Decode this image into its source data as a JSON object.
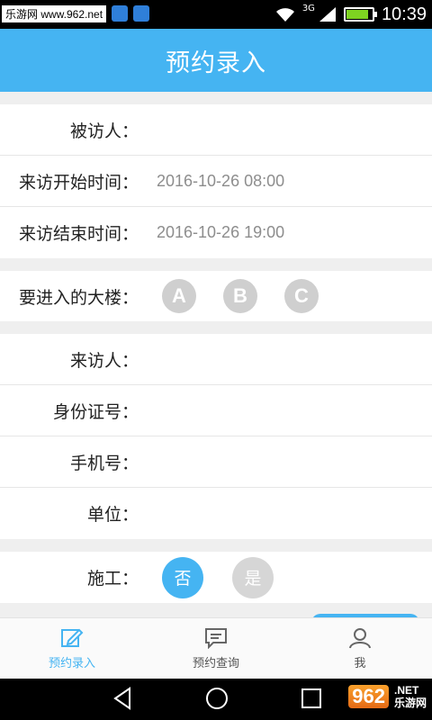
{
  "status_bar": {
    "watermark": "乐游网 www.962.net",
    "network": "3G",
    "time": "10:39",
    "battery_level": 0.85
  },
  "header": {
    "title": "预约录入"
  },
  "form": {
    "visitee_label": "被访人：",
    "visitee_value": "",
    "start_label": "来访开始时间：",
    "start_value": "2016-10-26 08:00",
    "end_label": "来访结束时间：",
    "end_value": "2016-10-26 19:00",
    "building_label": "要进入的大楼：",
    "buildings": [
      "A",
      "B",
      "C"
    ],
    "visitor_label": "来访人：",
    "visitor_value": "",
    "id_label": "身份证号：",
    "id_value": "",
    "phone_label": "手机号：",
    "phone_value": "",
    "company_label": "单位：",
    "company_value": "",
    "construction_label": "施工：",
    "construction_no": "否",
    "construction_yes": "是",
    "construction_selected": "否"
  },
  "bottom_nav": {
    "items": [
      {
        "label": "预约录入",
        "icon": "edit-icon",
        "active": true
      },
      {
        "label": "预约查询",
        "icon": "chat-icon",
        "active": false
      },
      {
        "label": "我",
        "icon": "user-icon",
        "active": false
      }
    ]
  },
  "system_nav": {
    "watermark_num": "962",
    "watermark_suffix": ".NET",
    "watermark_cn": "乐游网"
  },
  "colors": {
    "accent": "#45b4f2",
    "inactive": "#cfcfcf"
  }
}
